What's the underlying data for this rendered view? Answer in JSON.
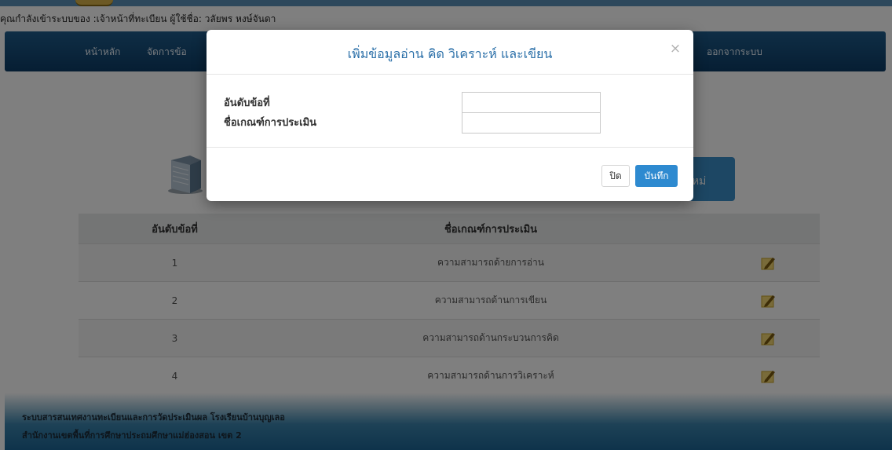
{
  "header": {
    "login_status": "คุณกำลังเข้าระบบของ :เจ้าหน้าที่ทะเบียน ผู้ใช้ชื่อ: วลัยพร หงษ์จันดา"
  },
  "nav": {
    "items": [
      "หน้าหลัก",
      "จัดการข้อ",
      "ออกจากระบบ"
    ]
  },
  "page": {
    "add_button_label": "ใหม่"
  },
  "table": {
    "columns": [
      "อันดับข้อที่",
      "ชื่อเกณฑ์การประเมิน"
    ],
    "rows": [
      {
        "no": "1",
        "name": "ความสามารถด้ายการอ่าน"
      },
      {
        "no": "2",
        "name": "ความสามารถด้านการเขียน"
      },
      {
        "no": "3",
        "name": "ความสามารถด้านกระบวนการคิด"
      },
      {
        "no": "4",
        "name": "ความสามารถด้านการวิเคราะห์"
      }
    ]
  },
  "footer": {
    "line1": "ระบบสารสนเทศงานทะเบียนและการวัดประเมินผล โรงเรียนบ้านบุญเลอ",
    "line2": "สำนักงานเขตพื้นที่การศึกษาประถมศึกษาแม่ฮ่องสอน เขต 2"
  },
  "modal": {
    "title": "เพิ่มข้อมูลอ่าน คิด วิเคราะห์ และเขียน",
    "close_icon": "×",
    "field_order_label": "อันดับข้อที่",
    "field_order_value": "",
    "field_name_label": "ชื่อเกณฑ์การประเมิน",
    "field_name_value": "",
    "close_button": "ปิด",
    "save_button": "บันทึก"
  },
  "colors": {
    "navbar": "#1f5d8c",
    "primary_button": "#2e8ad0",
    "modal_title": "#2a6fa8"
  },
  "icons": {
    "edit": "edit-icon",
    "building": "building-icon"
  }
}
